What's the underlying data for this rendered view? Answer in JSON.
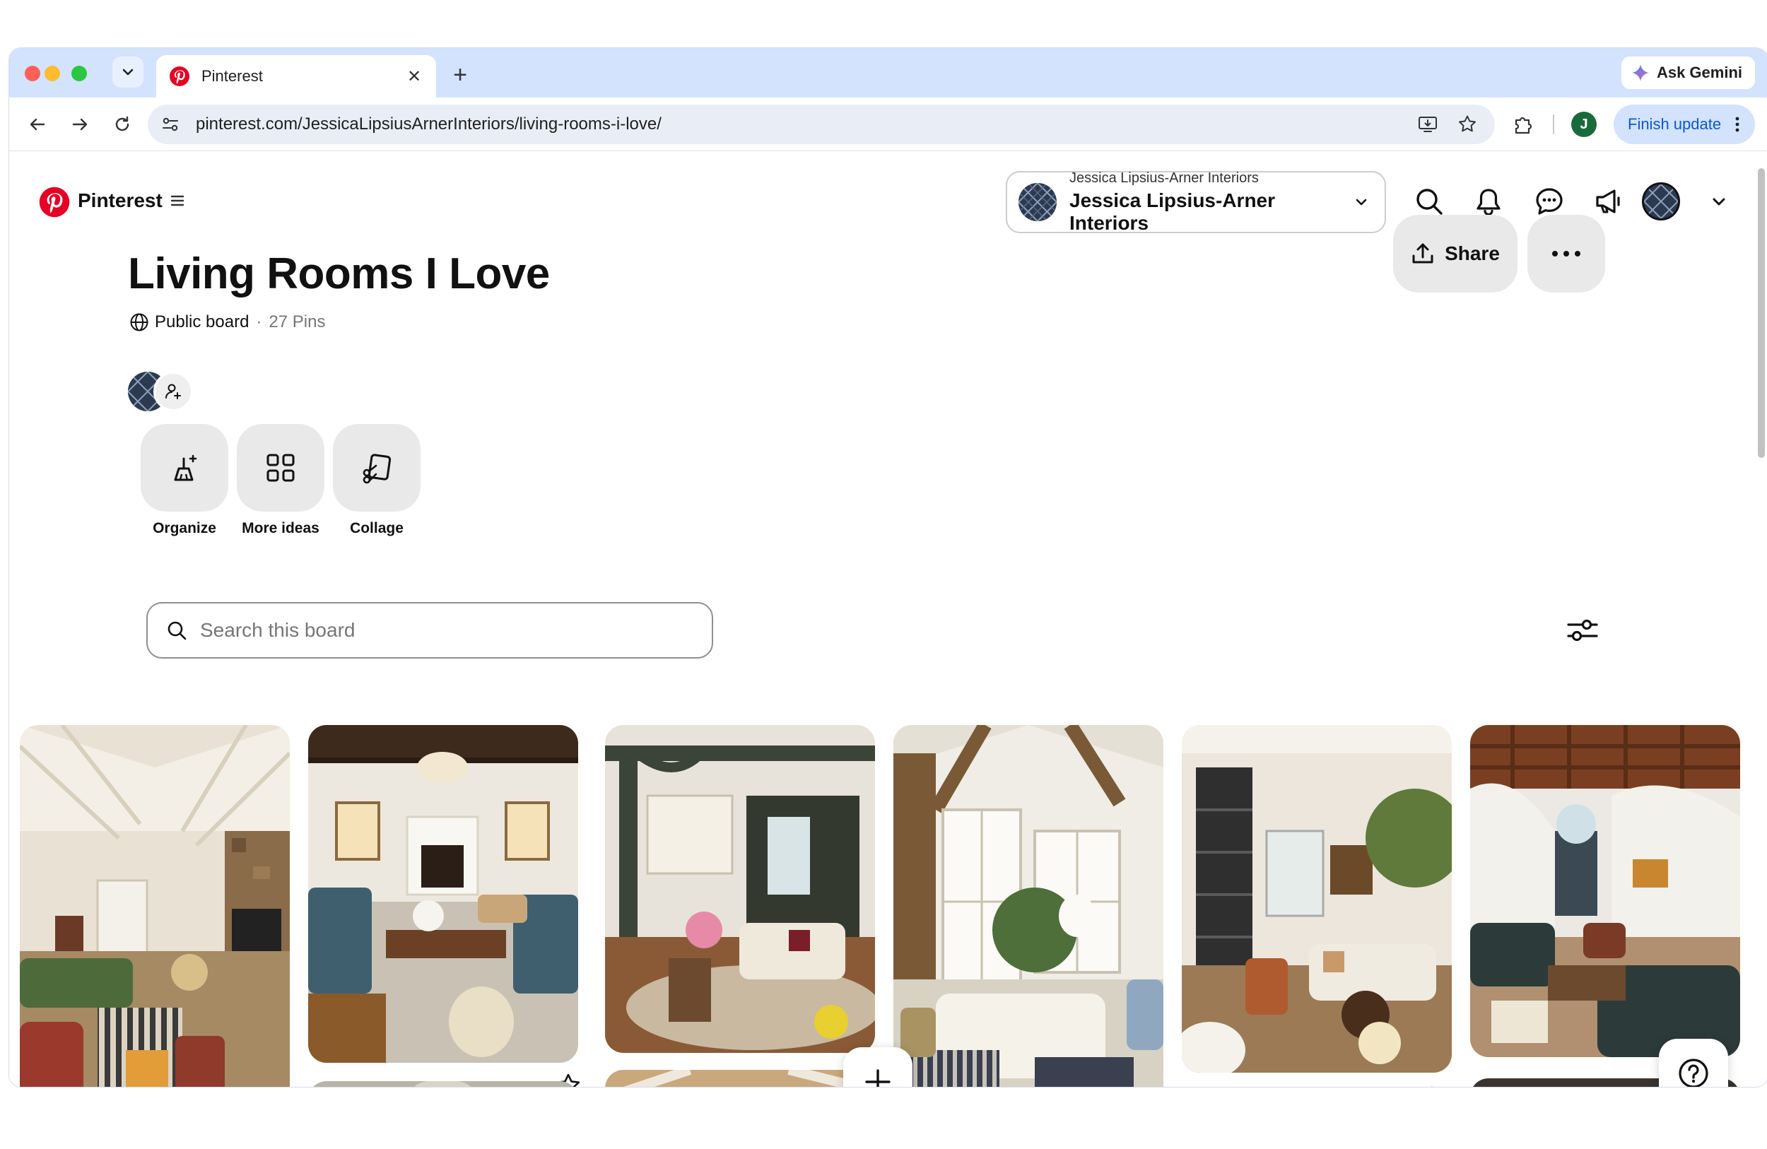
{
  "browser": {
    "tab_title": "Pinterest",
    "new_tab": "+",
    "gemini_label": "Ask Gemini",
    "url": "pinterest.com/JessicaLipsiusArnerInteriors/living-rooms-i-love/",
    "profile_initial": "J",
    "finish_update_label": "Finish update"
  },
  "header": {
    "brand": "Pinterest",
    "account_small": "Jessica Lipsius-Arner Interiors",
    "account_name": "Jessica Lipsius-Arner Interiors"
  },
  "board": {
    "title": "Living Rooms I Love",
    "visibility": "Public board",
    "separator": "·",
    "pin_count": "27 Pins",
    "share_label": "Share"
  },
  "tools": [
    {
      "label": "Organize",
      "icon": "organize-broom-icon"
    },
    {
      "label": "More ideas",
      "icon": "grid-icon"
    },
    {
      "label": "Collage",
      "icon": "collage-scissors-icon"
    }
  ],
  "search": {
    "placeholder": "Search this board",
    "value": ""
  },
  "pins": [
    {
      "scene": "vaulted cottage living room with stone fireplace",
      "palette": [
        "#e9e2d4",
        "#8a6b4a",
        "#4d6b3a",
        "#9b3a2c"
      ]
    },
    {
      "scene": "living room with blue sofas and white fireplace",
      "palette": [
        "#ede8df",
        "#3f5f6e",
        "#8a5a2a",
        "#c9c2b4"
      ]
    },
    {
      "scene": "living room with dark green trim and patterned rug",
      "palette": [
        "#e8e3da",
        "#3a4438",
        "#6b4a30",
        "#c9b9a0"
      ]
    },
    {
      "scene": "white paneled room with french doors and plants",
      "palette": [
        "#f0ede6",
        "#7a5a36",
        "#4e6e3a",
        "#d8d2c4"
      ]
    },
    {
      "scene": "living room with built-in shelves and tree",
      "palette": [
        "#ece6dc",
        "#2f2f2f",
        "#5f7a3a",
        "#c89a6a"
      ]
    },
    {
      "scene": "arched living room with wood beams and dark sofas",
      "palette": [
        "#ece9e4",
        "#7a3f22",
        "#2d3a3a",
        "#b09070"
      ]
    }
  ],
  "colors": {
    "pinterest_red": "#e60023",
    "tab_strip": "#d3e3fd",
    "button_gray": "#e9e9e9"
  }
}
